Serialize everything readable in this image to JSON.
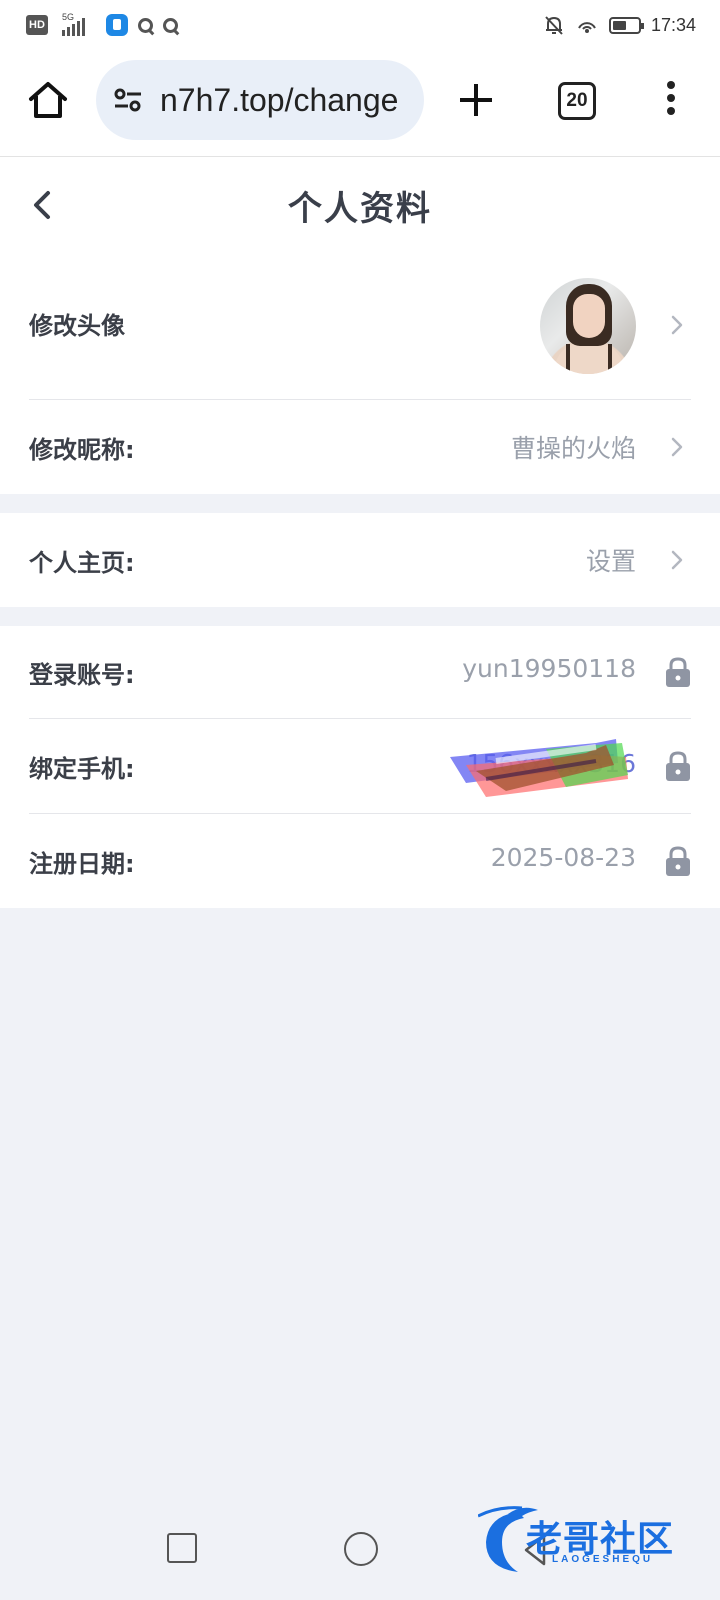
{
  "status_bar": {
    "hd_label": "HD",
    "network_label": "5G",
    "time": "17:34"
  },
  "browser": {
    "url": "n7h7.top/change",
    "tab_count": "20",
    "icons": {
      "home": "home-icon",
      "site_settings": "tune-icon",
      "new_tab": "plus-icon",
      "tabs": "tabs-icon",
      "menu": "more-vert-icon"
    }
  },
  "header": {
    "title": "个人资料"
  },
  "profile": {
    "avatar_label": "修改头像",
    "nickname_label": "修改昵称:",
    "nickname_value": "曹操的火焰",
    "homepage_label": "个人主页:",
    "homepage_value": "设置",
    "account_label": "登录账号:",
    "account_value": "yun19950118",
    "phone_label": "绑定手机:",
    "phone_value": "156xxxxx316",
    "register_label": "注册日期:",
    "register_value": "2025-08-23"
  },
  "watermark": {
    "text": "老哥社区",
    "sub": "LAOGESHEQU"
  },
  "colors": {
    "background": "#f0f2f7",
    "label": "#3b3f48",
    "value": "#9aa0ab",
    "watermark": "#1b6fe0"
  }
}
